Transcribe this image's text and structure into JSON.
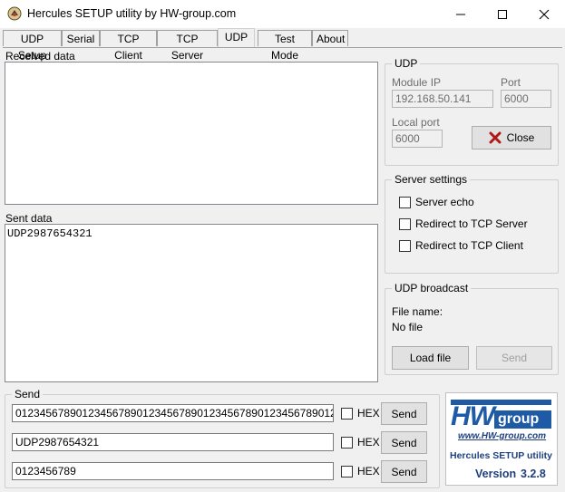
{
  "window": {
    "title": "Hercules SETUP utility by HW-group.com"
  },
  "tabs": [
    {
      "label": "UDP Setup"
    },
    {
      "label": "Serial"
    },
    {
      "label": "TCP Client"
    },
    {
      "label": "TCP Server"
    },
    {
      "label": "UDP"
    },
    {
      "label": "Test Mode"
    },
    {
      "label": "About"
    }
  ],
  "received": {
    "label": "Received data",
    "content": ""
  },
  "sent": {
    "label": "Sent data",
    "content": "UDP2987654321"
  },
  "udp": {
    "title": "UDP",
    "module_ip_label": "Module IP",
    "module_ip": "192.168.50.141",
    "port_label": "Port",
    "port": "6000",
    "local_port_label": "Local port",
    "local_port": "6000",
    "close_label": "Close"
  },
  "server_settings": {
    "title": "Server settings",
    "options": [
      {
        "label": "Server echo"
      },
      {
        "label": "Redirect to TCP Server"
      },
      {
        "label": "Redirect to TCP Client"
      }
    ]
  },
  "broadcast": {
    "title": "UDP broadcast",
    "file_name_label": "File name:",
    "file_name": "No file",
    "load_label": "Load file",
    "send_label": "Send"
  },
  "send_group": {
    "title": "Send",
    "rows": [
      {
        "value": "0123456789012345678901234567890123456789012345678901234567890123456789",
        "hex": "HEX",
        "send": "Send"
      },
      {
        "value": "UDP2987654321",
        "hex": "HEX",
        "send": "Send"
      },
      {
        "value": "0123456789",
        "hex": "HEX",
        "send": "Send"
      }
    ]
  },
  "logo": {
    "brand_hw": "HW",
    "brand_group": "group",
    "url": "www.HW-group.com",
    "product": "Hercules SETUP utility",
    "version_label": "Version",
    "version": "3.2.8"
  }
}
